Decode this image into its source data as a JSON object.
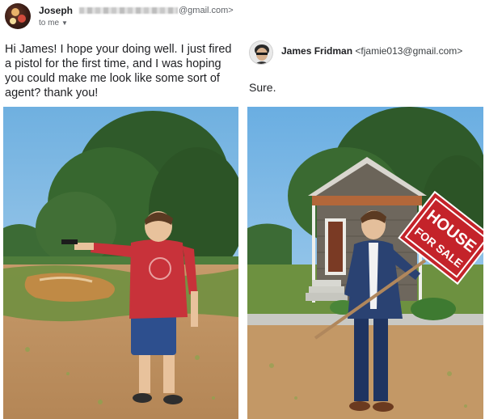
{
  "original_email": {
    "sender_name": "Joseph",
    "sender_email": "@gmail.com>",
    "recipient": "to me",
    "body": "Hi James! I hope your doing well. I just fired a pistol for the first time, and I was hoping you could make me look like some sort of agent? thank you!"
  },
  "reply": {
    "sender_name": "James Fridman",
    "sender_email": "<fjamie013@gmail.com>",
    "body": "Sure."
  },
  "photo_after": {
    "sign_line1": "HOUSE",
    "sign_line2": "FOR SALE"
  },
  "colors": {
    "shirt_red": "#c8323a",
    "shorts_blue": "#2d4f8e",
    "suit_blue": "#2a4272",
    "sign_red": "#c4232a"
  }
}
